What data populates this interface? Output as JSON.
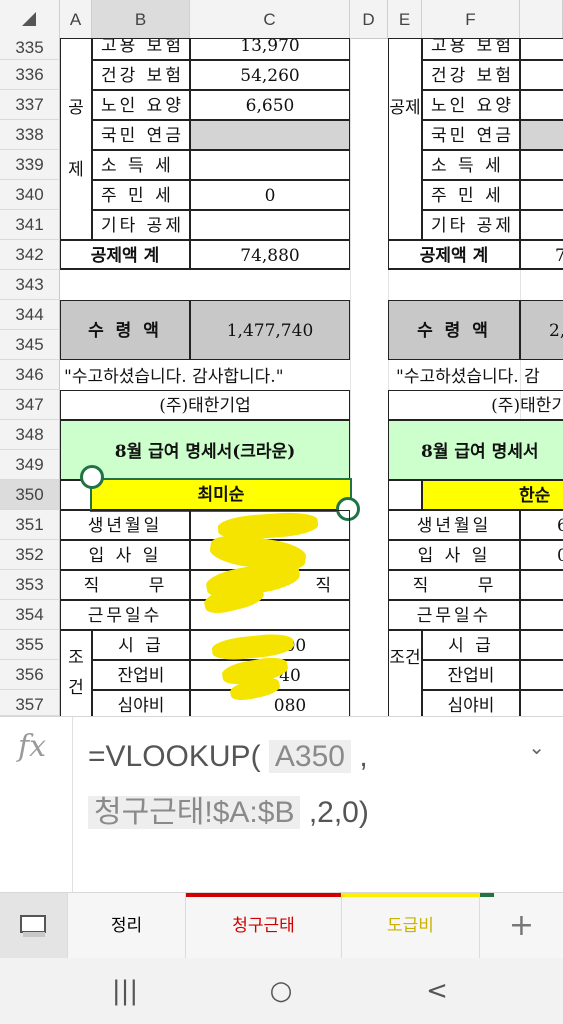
{
  "columns": [
    "A",
    "B",
    "C",
    "D",
    "E",
    "F"
  ],
  "selected_column": "B",
  "rows": [
    "335",
    "336",
    "337",
    "338",
    "339",
    "340",
    "341",
    "342",
    "343",
    "344",
    "345",
    "346",
    "347",
    "348",
    "349",
    "350",
    "351",
    "352",
    "353",
    "354",
    "355",
    "356",
    "357"
  ],
  "selected_row": "350",
  "left": {
    "deduction_group": "공제",
    "items": [
      {
        "label": "고용 보험",
        "value": "13,970"
      },
      {
        "label": "건강 보험",
        "value": "54,260"
      },
      {
        "label": "노인 요양",
        "value": "6,650"
      },
      {
        "label": "국민 연금",
        "value": ""
      },
      {
        "label": "소 득 세",
        "value": ""
      },
      {
        "label": "주 민 세",
        "value": "0"
      },
      {
        "label": "기타 공제",
        "value": ""
      }
    ],
    "total_label": "공제액 계",
    "total_value": "74,880",
    "net_label": "수 령 액",
    "net_value": "1,477,740",
    "thanks": "\"수고하셨습니다. 감사합니다.\"",
    "company": "(주)태한기업",
    "title": "8월 급여 명세서(크라운)",
    "name": "최미순",
    "info_labels": [
      "생년월일",
      "입 사 일",
      "직 무",
      "근무일수"
    ],
    "cond_group": "조건",
    "cond_labels": [
      "시 급",
      "잔업비",
      "심야비"
    ],
    "cond_partials": [
      "100",
      "40",
      "080"
    ],
    "info_partial": "직"
  },
  "right": {
    "deduction_group": "공제",
    "items": [
      "고용 보험",
      "건강 보험",
      "노인 요양",
      "국민 연금",
      "소 득 세",
      "주 민 세",
      "기타 공제"
    ],
    "total_label": "공제액 계",
    "total_partial": "7",
    "net_label": "수 령 액",
    "net_partial": "2,",
    "thanks": "\"수고하셨습니다. 감",
    "company": "(주)태한기",
    "title": "8월 급여 명세서",
    "name": "한순",
    "info_labels": [
      "생년월일",
      "입 사 일",
      "직 무",
      "근무일수"
    ],
    "info_partials": [
      "6",
      "0"
    ],
    "cond_group": "조건",
    "cond_labels": [
      "시 급",
      "잔업비",
      "심야비"
    ]
  },
  "formula": {
    "fx_label": "fx",
    "prefix": "=VLOOKUP(",
    "arg1": "A350",
    "sep1": ",",
    "arg2": "청구근태!$A:$B",
    "suffix": ",2,0)"
  },
  "tabs": [
    {
      "label": "정리",
      "color": "#333333",
      "bar": ""
    },
    {
      "label": "청구근태",
      "color": "#d00000",
      "bar": "#d00000"
    },
    {
      "label": "도급비",
      "color": "#c9b300",
      "bar": "#ffee00"
    }
  ],
  "add_sheet_label": "+",
  "nav": {
    "recent": "|||",
    "home": "○",
    "back": "<"
  }
}
